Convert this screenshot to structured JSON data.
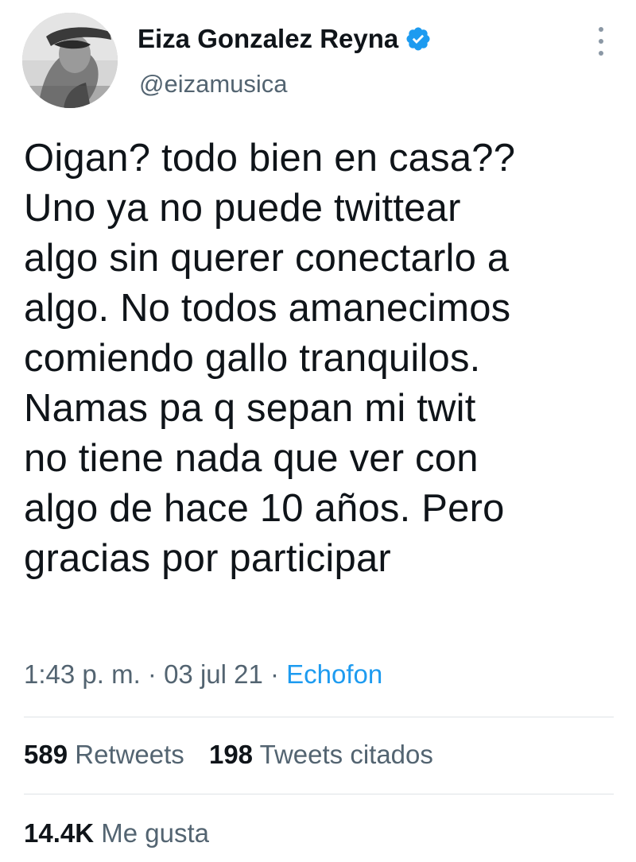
{
  "author": {
    "display_name": "Eiza Gonzalez Reyna",
    "handle": "@eizamusica",
    "verified": true,
    "avatar_icon": "profile-photo"
  },
  "tweet": {
    "lines": [
      "Oigan? todo bien en casa??",
      "Uno ya no puede twittear",
      "algo sin querer conectarlo a",
      "algo. No todos amanecimos",
      "comiendo gallo tranquilos.",
      "Namas pa q sepan mi twit",
      "no tiene nada que ver con",
      "algo de hace 10 años. Pero",
      "gracias por participar"
    ],
    "time": "1:43 p. m.",
    "separator": " · ",
    "date": "03 jul 21",
    "source": "Echofon"
  },
  "stats": {
    "retweets_count": "589",
    "retweets_label": "Retweets",
    "quotes_count": "198",
    "quotes_label": "Tweets citados",
    "likes_count": "14.4K",
    "likes_label": "Me gusta"
  },
  "colors": {
    "accent": "#1d9bf0",
    "secondary_text": "#536471",
    "primary_text": "#0f1419",
    "divider": "#dfe3e6"
  }
}
